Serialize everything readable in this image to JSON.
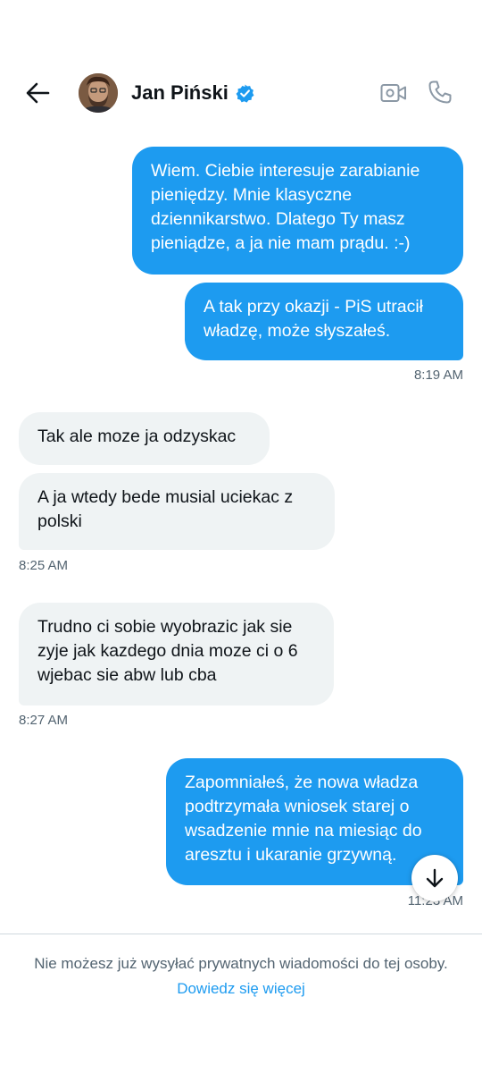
{
  "header": {
    "contact_name": "Jan Piński",
    "back_icon": "arrow-left-icon",
    "verified_icon": "verified-badge-icon",
    "video_icon": "video-camera-icon",
    "phone_icon": "phone-icon"
  },
  "messages": [
    {
      "direction": "outgoing",
      "text": "Wiem. Ciebie interesuje zarabianie pieniędzy. Mnie klasyczne dziennikarstwo. Dlatego Ty masz pieniądze, a ja nie mam prądu. :-)"
    },
    {
      "direction": "outgoing",
      "text": "A tak przy okazji - PiS utracił władzę, może słyszałeś.",
      "time": "8:19 AM"
    },
    {
      "direction": "incoming",
      "text": "Tak ale moze ja odzyskac"
    },
    {
      "direction": "incoming",
      "text": "A ja wtedy bede musial uciekac z polski",
      "time": "8:25 AM"
    },
    {
      "direction": "incoming",
      "text": "Trudno ci sobie wyobrazic jak sie zyje jak kazdego dnia moze ci o 6 wjebac sie abw lub cba",
      "time": "8:27 AM"
    },
    {
      "direction": "outgoing",
      "text": "Zapomniałeś, że nowa władza podtrzymała wniosek starej o wsadzenie mnie na miesiąc do aresztu i ukaranie grzywną.",
      "time": "11:23 AM"
    }
  ],
  "scroll_down_icon": "arrow-down-icon",
  "footer": {
    "notice_text": "Nie możesz już wysyłać prywatnych wiadomości do tej osoby.",
    "learn_more_label": "Dowiedz się więcej"
  },
  "colors": {
    "outgoing_bubble": "#1d9bf0",
    "incoming_bubble": "#eff3f4",
    "link": "#1d9bf0",
    "muted_text": "#536471"
  }
}
